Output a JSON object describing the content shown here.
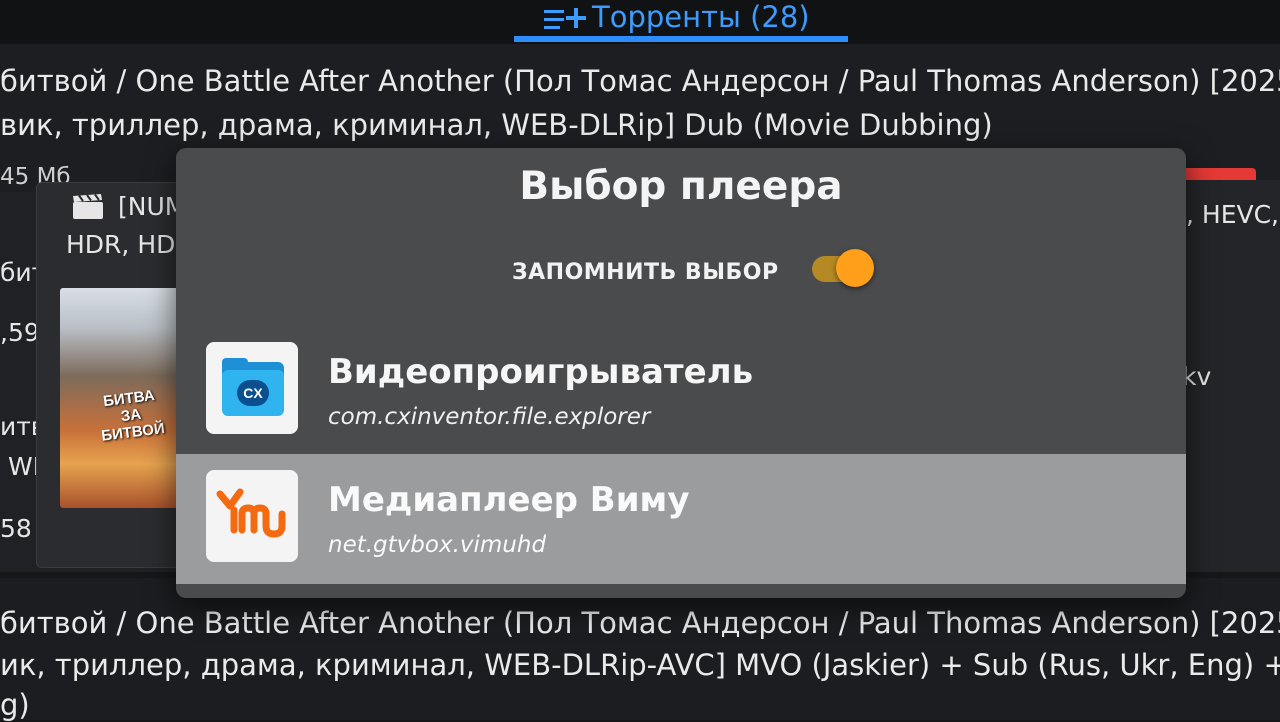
{
  "header": {
    "tab_label": "Торренты (28)",
    "accent": "#2f8cff"
  },
  "background_list": {
    "top_line1": "битвой / One Battle After Another (Пол Томас Андерсон / Paul Thomas Anderson) [2025,",
    "top_line2": "вик, триллер, драма, криминал, WEB-DLRip] Dub (Movie Dubbing)",
    "top_meta": "45 Мб",
    "card_title_prefix": "[NUM",
    "card_line2": "HDR, HD",
    "left_frag_1": "битв",
    "left_frag_2": ",59",
    "left_frag_3": "итв",
    "left_frag_4": "WI",
    "left_frag_5": "58",
    "right_frag_1": ", HEVC,",
    "right_frag_2": "kv",
    "poster_text": "БИТВА ЗА БИТВОЙ",
    "bottom_line1": "битвой / One Battle After Another (Пол Томас Андерсон / Paul Thomas Anderson) [2025,",
    "bottom_line2": "ик, триллер, драма, криминал, WEB-DLRip-AVC] MVO (Jaskier) + Sub (Rus, Ukr, Eng) +",
    "bottom_line3": "g)"
  },
  "dialog": {
    "title": "Выбор плеера",
    "remember_label": "ЗАПОМНИТЬ ВЫБОР",
    "remember_on": true,
    "toggle_color": "#ff9f1a",
    "players": [
      {
        "name": "Видеопроигрыватель",
        "package": "com.cxinventor.file.explorer",
        "icon": "folder-icon"
      },
      {
        "name": "Медиаплеер Виму",
        "package": "net.gtvbox.vimuhd",
        "icon": "vimu-icon"
      }
    ],
    "cx_badge": "CX",
    "selected_index": 1
  }
}
